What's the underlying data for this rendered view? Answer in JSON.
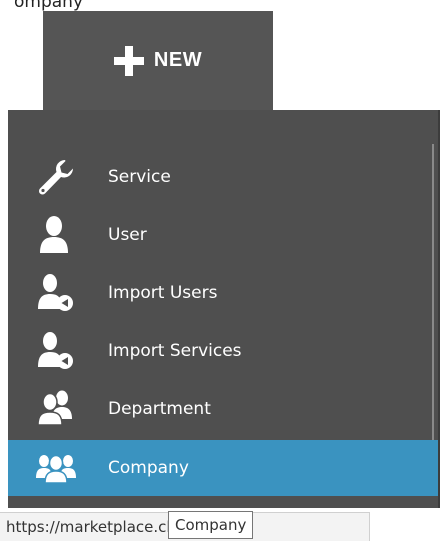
{
  "partial_top_text": "ompany",
  "new_button": {
    "label": "NEW",
    "icon": "plus-icon"
  },
  "menu": {
    "items": [
      {
        "label": "Service",
        "icon": "wrench-icon"
      },
      {
        "label": "User",
        "icon": "user-icon"
      },
      {
        "label": "Import Users",
        "icon": "import-user-icon"
      },
      {
        "label": "Import Services",
        "icon": "import-user-icon"
      },
      {
        "label": "Department",
        "icon": "user-pair-icon"
      },
      {
        "label": "Company",
        "icon": "user-group-icon",
        "active": true
      }
    ]
  },
  "status_bar": {
    "url": "https://marketplace.cloud.ru/#"
  },
  "tooltip": {
    "text": "Company"
  },
  "colors": {
    "button_bg": "#555555",
    "menu_bg": "#4f4f4f",
    "active_bg": "#3a93c0",
    "text": "#ffffff"
  }
}
